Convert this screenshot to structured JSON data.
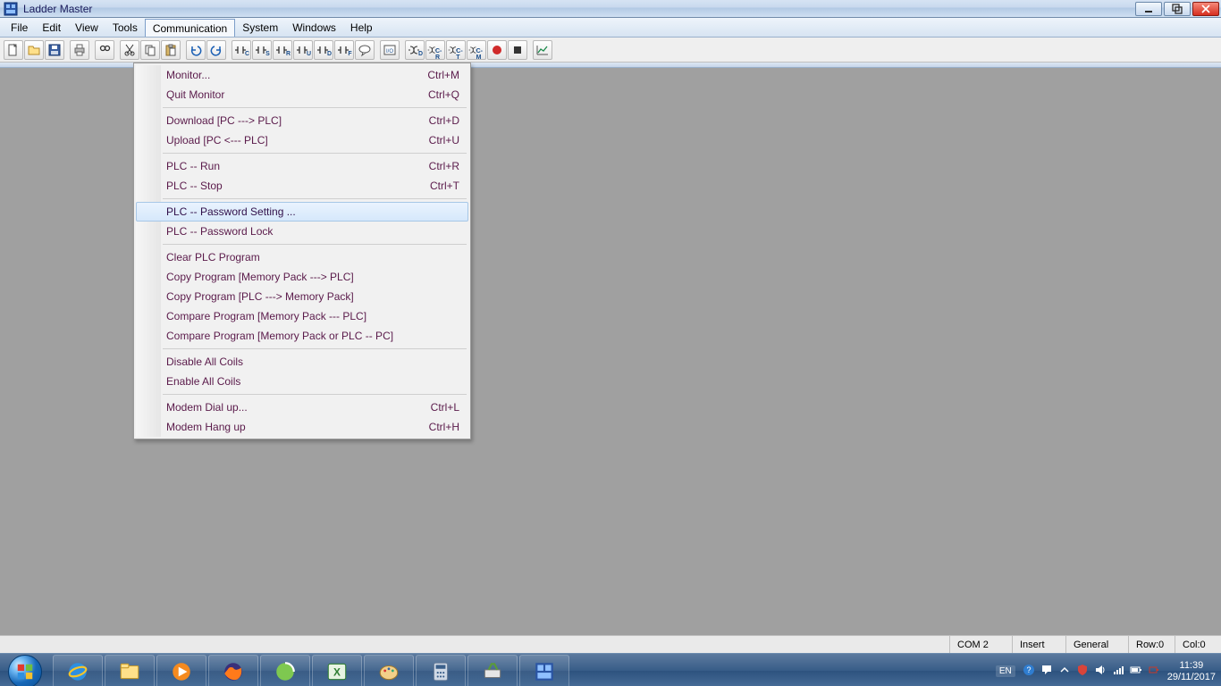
{
  "title": "Ladder Master",
  "menu": {
    "items": [
      "File",
      "Edit",
      "View",
      "Tools",
      "Communication",
      "System",
      "Windows",
      "Help"
    ],
    "active_index": 4
  },
  "dropdown": {
    "groups": [
      [
        {
          "label": "Monitor...",
          "shortcut": "Ctrl+M"
        },
        {
          "label": "Quit Monitor",
          "shortcut": "Ctrl+Q"
        }
      ],
      [
        {
          "label": "Download [PC ---> PLC]",
          "shortcut": "Ctrl+D"
        },
        {
          "label": "Upload [PC <--- PLC]",
          "shortcut": "Ctrl+U"
        }
      ],
      [
        {
          "label": "PLC -- Run",
          "shortcut": "Ctrl+R"
        },
        {
          "label": "PLC -- Stop",
          "shortcut": "Ctrl+T"
        }
      ],
      [
        {
          "label": "PLC -- Password Setting ...",
          "shortcut": "",
          "hover": true
        },
        {
          "label": "PLC -- Password Lock",
          "shortcut": ""
        }
      ],
      [
        {
          "label": "Clear PLC Program",
          "shortcut": ""
        },
        {
          "label": "Copy Program [Memory Pack ---> PLC]",
          "shortcut": ""
        },
        {
          "label": "Copy Program [PLC ---> Memory Pack]",
          "shortcut": ""
        },
        {
          "label": "Compare Program [Memory Pack --- PLC]",
          "shortcut": ""
        },
        {
          "label": "Compare Program [Memory Pack or PLC -- PC]",
          "shortcut": ""
        }
      ],
      [
        {
          "label": "Disable All Coils",
          "shortcut": ""
        },
        {
          "label": "Enable All Coils",
          "shortcut": ""
        }
      ],
      [
        {
          "label": "Modem Dial up...",
          "shortcut": "Ctrl+L"
        },
        {
          "label": "Modem Hang up",
          "shortcut": "Ctrl+H"
        }
      ]
    ]
  },
  "toolbar": {
    "icons": [
      "new-file",
      "open-file",
      "save-file",
      "|",
      "print",
      "|",
      "find",
      "|",
      "cut",
      "copy",
      "paste",
      "|",
      "undo",
      "redo",
      "|",
      "contact-open-c",
      "contact-open-s",
      "contact-closed-r",
      "contact-closed-u",
      "contact-diff-d",
      "contact-f",
      "comment",
      "|",
      "io-mod",
      "|",
      "coil-d",
      "coil-cr",
      "coil-ct",
      "coil-cm",
      "rec",
      "stop",
      "|",
      "chart"
    ],
    "sublabels": {
      "contact-open-c": "C",
      "contact-open-s": "S",
      "contact-closed-r": "R",
      "contact-closed-u": "U",
      "contact-diff-d": "D",
      "contact-f": "F",
      "coil-d": "D",
      "coil-cr": "C-R",
      "coil-ct": "C-T",
      "coil-cm": "C-M"
    }
  },
  "statusbar": {
    "com": "COM 2",
    "mode": "Insert",
    "general": "General",
    "row": "Row:0",
    "col": "Col:0"
  },
  "taskbar": {
    "lang": "EN",
    "time": "11:39",
    "date": "29/11/2017"
  }
}
